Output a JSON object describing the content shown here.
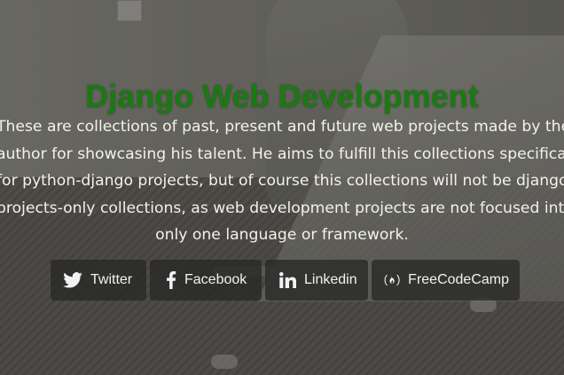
{
  "hero": {
    "title": "Django Web Development",
    "description_lines": [
      "These are collections of past, present and future web projects made by the",
      "author for showcasing his talent. He aims to fulfill this collections specifically",
      "for python-django projects, but of course this collections will not be django-",
      "projects-only collections, as web development projects are not focused into",
      "only one language or framework."
    ]
  },
  "socials": [
    {
      "label": "Twitter",
      "icon": "twitter-icon"
    },
    {
      "label": "Facebook",
      "icon": "facebook-icon"
    },
    {
      "label": "Linkedin",
      "icon": "linkedin-icon"
    },
    {
      "label": "FreeCodeCamp",
      "icon": "freecodecamp-icon"
    }
  ],
  "colors": {
    "title": "#1a7a12",
    "text": "#f3f1ea",
    "button_bg": "#282826"
  }
}
